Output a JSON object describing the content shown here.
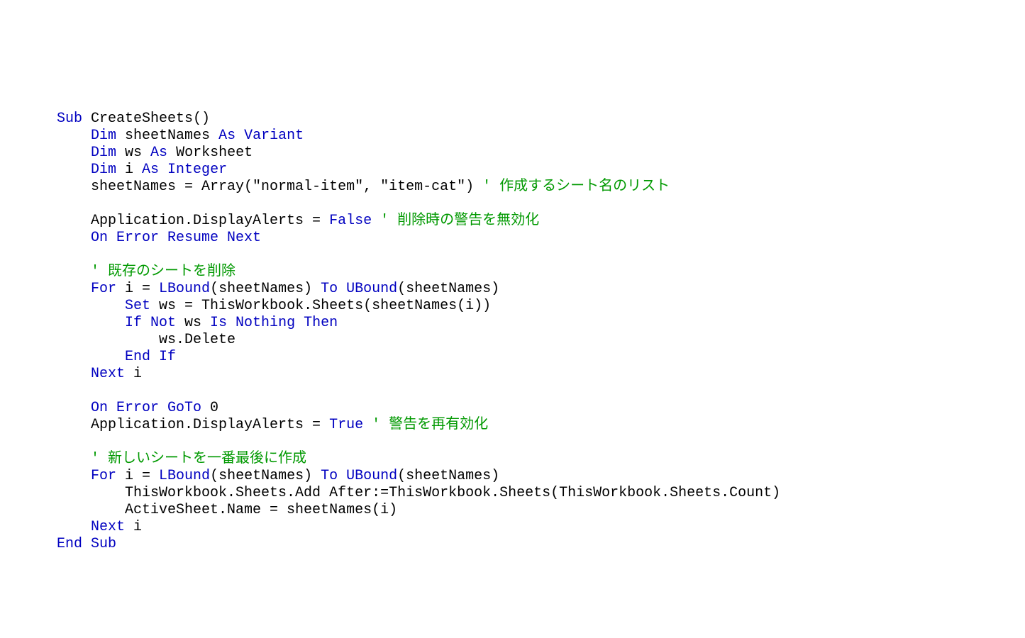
{
  "code": {
    "tokens": [
      [
        {
          "t": "Sub",
          "c": "kw"
        },
        {
          "t": " CreateSheets()"
        }
      ],
      [
        {
          "t": "    "
        },
        {
          "t": "Dim",
          "c": "kw"
        },
        {
          "t": " sheetNames "
        },
        {
          "t": "As Variant",
          "c": "kw"
        }
      ],
      [
        {
          "t": "    "
        },
        {
          "t": "Dim",
          "c": "kw"
        },
        {
          "t": " ws "
        },
        {
          "t": "As",
          "c": "kw"
        },
        {
          "t": " Worksheet"
        }
      ],
      [
        {
          "t": "    "
        },
        {
          "t": "Dim",
          "c": "kw"
        },
        {
          "t": " i "
        },
        {
          "t": "As Integer",
          "c": "kw"
        }
      ],
      [
        {
          "t": "    sheetNames = Array(\"normal-item\", \"item-cat\") "
        },
        {
          "t": "' 作成するシート名のリスト",
          "c": "cm"
        }
      ],
      [
        {
          "t": ""
        }
      ],
      [
        {
          "t": "    Application.DisplayAlerts = "
        },
        {
          "t": "False",
          "c": "kw"
        },
        {
          "t": " "
        },
        {
          "t": "' 削除時の警告を無効化",
          "c": "cm"
        }
      ],
      [
        {
          "t": "    "
        },
        {
          "t": "On Error Resume Next",
          "c": "kw"
        }
      ],
      [
        {
          "t": ""
        }
      ],
      [
        {
          "t": "    "
        },
        {
          "t": "' 既存のシートを削除",
          "c": "cm"
        }
      ],
      [
        {
          "t": "    "
        },
        {
          "t": "For",
          "c": "kw"
        },
        {
          "t": " i = "
        },
        {
          "t": "LBound",
          "c": "kw"
        },
        {
          "t": "(sheetNames) "
        },
        {
          "t": "To",
          "c": "kw"
        },
        {
          "t": " "
        },
        {
          "t": "UBound",
          "c": "kw"
        },
        {
          "t": "(sheetNames)"
        }
      ],
      [
        {
          "t": "        "
        },
        {
          "t": "Set",
          "c": "kw"
        },
        {
          "t": " ws = ThisWorkbook.Sheets(sheetNames(i))"
        }
      ],
      [
        {
          "t": "        "
        },
        {
          "t": "If Not",
          "c": "kw"
        },
        {
          "t": " ws "
        },
        {
          "t": "Is Nothing Then",
          "c": "kw"
        }
      ],
      [
        {
          "t": "            ws.Delete"
        }
      ],
      [
        {
          "t": "        "
        },
        {
          "t": "End If",
          "c": "kw"
        }
      ],
      [
        {
          "t": "    "
        },
        {
          "t": "Next",
          "c": "kw"
        },
        {
          "t": " i"
        }
      ],
      [
        {
          "t": ""
        }
      ],
      [
        {
          "t": "    "
        },
        {
          "t": "On Error GoTo",
          "c": "kw"
        },
        {
          "t": " 0"
        }
      ],
      [
        {
          "t": "    Application.DisplayAlerts = "
        },
        {
          "t": "True",
          "c": "kw"
        },
        {
          "t": " "
        },
        {
          "t": "' 警告を再有効化",
          "c": "cm"
        }
      ],
      [
        {
          "t": ""
        }
      ],
      [
        {
          "t": "    "
        },
        {
          "t": "' 新しいシートを一番最後に作成",
          "c": "cm"
        }
      ],
      [
        {
          "t": "    "
        },
        {
          "t": "For",
          "c": "kw"
        },
        {
          "t": " i = "
        },
        {
          "t": "LBound",
          "c": "kw"
        },
        {
          "t": "(sheetNames) "
        },
        {
          "t": "To",
          "c": "kw"
        },
        {
          "t": " "
        },
        {
          "t": "UBound",
          "c": "kw"
        },
        {
          "t": "(sheetNames)"
        }
      ],
      [
        {
          "t": "        ThisWorkbook.Sheets.Add After:=ThisWorkbook.Sheets(ThisWorkbook.Sheets.Count)"
        }
      ],
      [
        {
          "t": "        ActiveSheet.Name = sheetNames(i)"
        }
      ],
      [
        {
          "t": "    "
        },
        {
          "t": "Next",
          "c": "kw"
        },
        {
          "t": " i"
        }
      ],
      [
        {
          "t": "End Sub",
          "c": "kw"
        }
      ]
    ]
  }
}
